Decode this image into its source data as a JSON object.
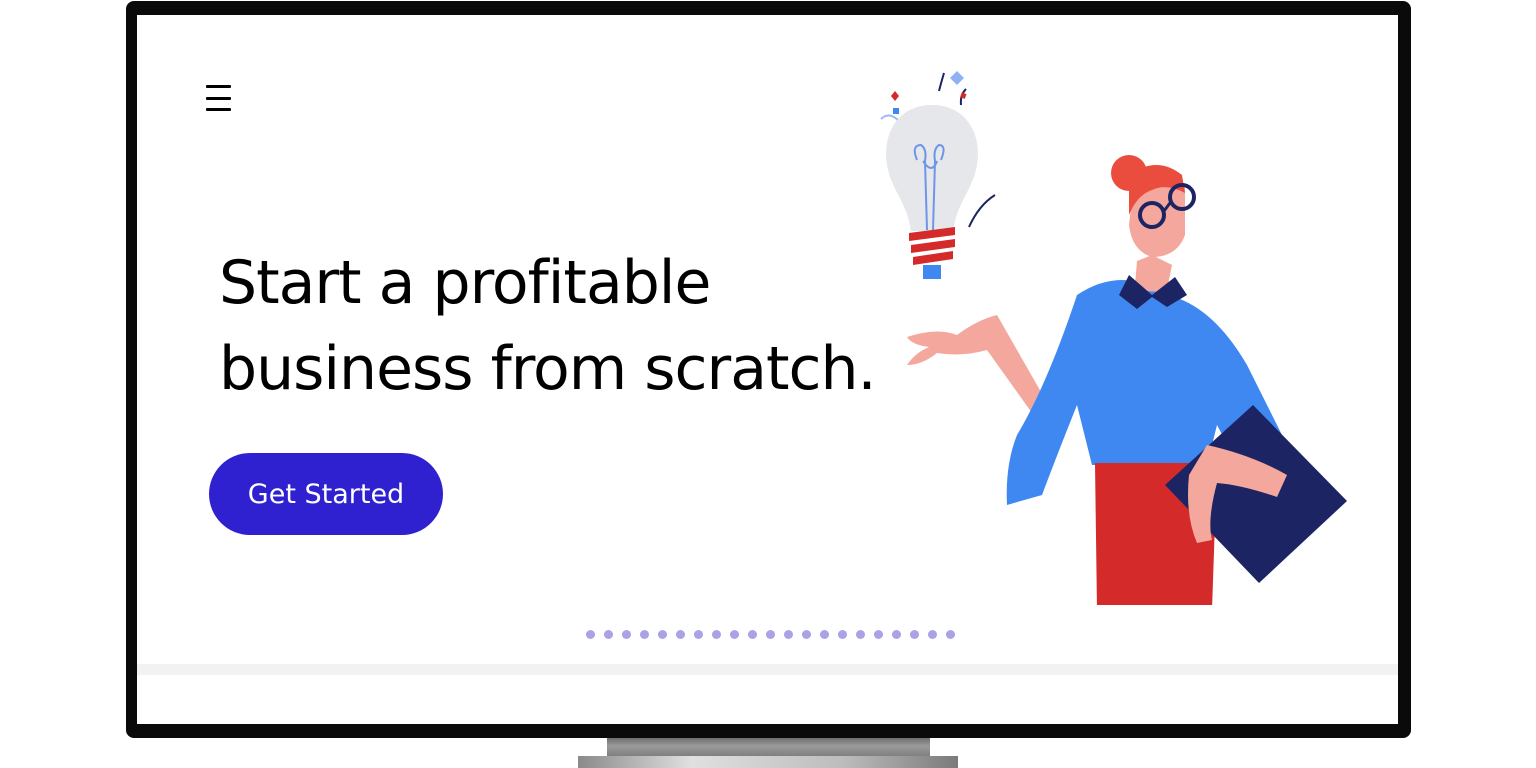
{
  "header": {
    "menu_icon": "hamburger-menu-icon"
  },
  "hero": {
    "title_line1": "Start a profitable",
    "title_line2": "business from scratch.",
    "cta_label": "Get Started"
  },
  "carousel": {
    "dot_count": 21
  },
  "illustration": {
    "subject": "woman-with-lightbulb-illustration"
  },
  "colors": {
    "accent": "#3021d0",
    "dots": "#a9a3e6",
    "shirt": "#3f88f2",
    "skirt": "#d52a2a",
    "folder": "#1d2463",
    "skin": "#f4a79c"
  }
}
